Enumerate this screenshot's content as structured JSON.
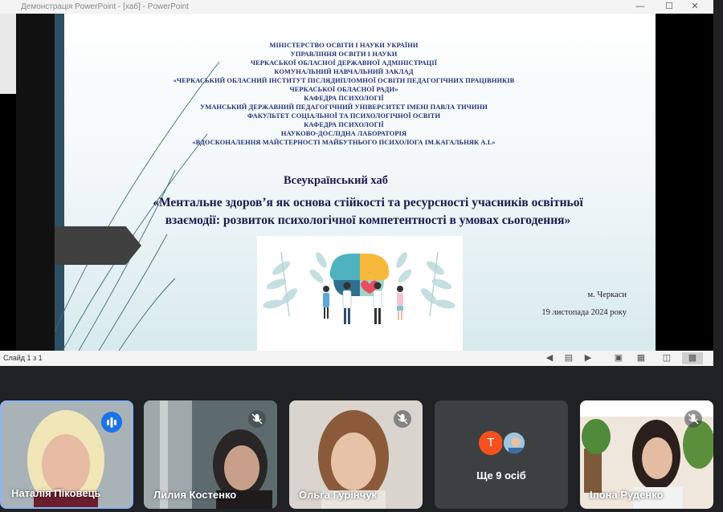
{
  "window": {
    "title": "Демонстрація PowerPoint - [хаб] - PowerPoint",
    "minimize_icon": "minimize-icon",
    "maximize_icon": "maximize-icon",
    "close_icon": "close-icon"
  },
  "slide": {
    "header_lines": [
      "МІНІСТЕРСТВО ОСВІТИ І НАУКИ УКРАЇНИ",
      "УПРАВЛІННЯ ОСВІТИ І НАУКИ",
      "ЧЕРКАСЬКОЇ ОБЛАСНОЇ ДЕРЖАВНОЇ АДМІНІСТРАЦІЇ",
      "КОМУНАЛЬНИЙ НАВЧАЛЬНИЙ ЗАКЛАД",
      "«ЧЕРКАСЬКИЙ ОБЛАСНИЙ ІНСТИТУТ ПІСЛЯДИПЛОМНОЇ ОСВІТИ ПЕДАГОГІЧНИХ ПРАЦІВНИКІВ",
      "ЧЕРКАСЬКОЇ ОБЛАСНОЇ РАДИ»",
      "КАФЕДРА ПСИХОЛОГІЇ",
      "УМАНСЬКИЙ ДЕРЖАВНИЙ ПЕДАГОГІЧНИЙ УНІВЕРСИТЕТ ІМЕНІ ПАВЛА ТИЧИНИ",
      "ФАКУЛЬТЕТ СОЦІАЛЬНОЇ ТА ПСИХОЛОГІЧНОЇ ОСВІТИ",
      "КАФЕДРА ПСИХОЛОГІЇ",
      "НАУКОВО-ДОСЛІДНА ЛАБОРАТОРІЯ",
      "«ВДОСКОНАЛЕННЯ МАЙСТЕРНОСТІ МАЙБУТНЬОГО ПСИХОЛОГА ІМ.КАГАЛЬНЯК А.І.»"
    ],
    "hub_title": "Всеукраїнський хаб",
    "theme_line1": "«Ментальне здоров’я як основа стійкості та ресурсності учасників освітньої",
    "theme_line2": "взаємодії: розвиток психологічної компетентності в умовах сьогодення»",
    "city": "м. Черкаси",
    "date": "19 листопада 2024 року",
    "colors": {
      "header_text": "#1f2f7a",
      "title_text": "#1a1a4e",
      "accent_strip": "#2d4f63"
    }
  },
  "statusbar": {
    "slide_counter": "Слайд 1 з 1",
    "icons": [
      "previous-icon",
      "notes-icon",
      "next-icon",
      "normal-view-icon",
      "slide-sorter-icon",
      "reading-view-icon",
      "slideshow-icon"
    ]
  },
  "participants": [
    {
      "name": "Наталія Піковець",
      "state": "speaking",
      "icon": "speaking-icon"
    },
    {
      "name": "Лилия Костенко",
      "state": "muted",
      "icon": "mic-off-icon"
    },
    {
      "name": "Ольга Гурінчук",
      "state": "muted",
      "icon": "mic-off-icon"
    },
    {
      "name": "Ще 9 осіб",
      "avatar_letter": "T",
      "avatar_color": "#f4511e"
    },
    {
      "name": "Ілона Руденко",
      "state": "muted",
      "icon": "mic-off-icon"
    }
  ],
  "colors": {
    "meet_bg": "#202124",
    "tile_bg": "#3c4043",
    "speaking_accent": "#8ab4f8"
  }
}
